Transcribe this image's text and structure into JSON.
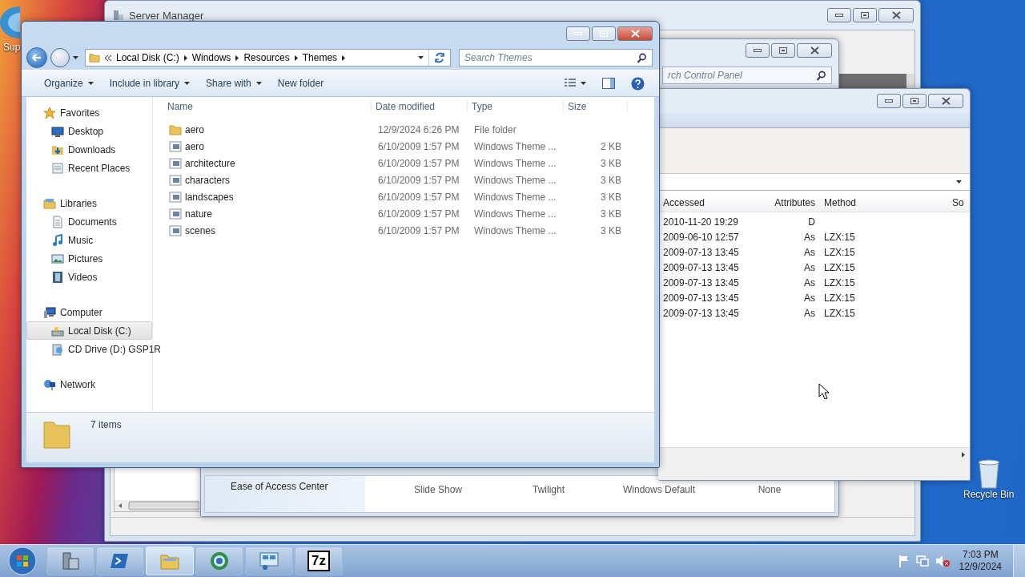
{
  "desktop": {
    "icons": [
      {
        "label": "Sup",
        "kind": "shortcut"
      },
      {
        "label": "Recycle Bin",
        "kind": "recycle"
      }
    ]
  },
  "server_manager": {
    "title": "Server Manager"
  },
  "control_panel": {
    "search": {
      "placeholder": "rch Control Panel"
    },
    "theme_row": {
      "label": "Ease of Access Center",
      "values": [
        "Slide Show",
        "Twilight",
        "Windows Default",
        "None"
      ]
    }
  },
  "archive": {
    "columns": [
      "Accessed",
      "Attributes",
      "Method",
      "So"
    ],
    "rows": [
      {
        "accessed": "2010-11-20 19:29",
        "attributes": "D"
      },
      {
        "accessed": "2009-06-10 12:57",
        "attributes": "As",
        "method": "LZX:15"
      },
      {
        "accessed": "2009-07-13 13:45",
        "attributes": "As",
        "method": "LZX:15"
      },
      {
        "accessed": "2009-07-13 13:45",
        "attributes": "As",
        "method": "LZX:15"
      },
      {
        "accessed": "2009-07-13 13:45",
        "attributes": "As",
        "method": "LZX:15"
      },
      {
        "accessed": "2009-07-13 13:45",
        "attributes": "As",
        "method": "LZX:15"
      },
      {
        "accessed": "2009-07-13 13:45",
        "attributes": "As",
        "method": "LZX:15"
      }
    ]
  },
  "explorer": {
    "breadcrumb": [
      "Local Disk (C:)",
      "Windows",
      "Resources",
      "Themes"
    ],
    "search": {
      "placeholder": "Search Themes"
    },
    "toolbar": [
      {
        "label": "Organize",
        "dropdown": true
      },
      {
        "label": "Include in library",
        "dropdown": true
      },
      {
        "label": "Share with",
        "dropdown": true
      },
      {
        "label": "New folder",
        "dropdown": false
      }
    ],
    "nav": [
      {
        "label": "Favorites",
        "kind": "star",
        "selected": false,
        "children": [
          {
            "label": "Desktop",
            "kind": "desktop",
            "selected": false
          },
          {
            "label": "Downloads",
            "kind": "downloads",
            "selected": false
          },
          {
            "label": "Recent Places",
            "kind": "recent",
            "selected": false
          }
        ]
      },
      {
        "label": "Libraries",
        "kind": "library",
        "selected": false,
        "children": [
          {
            "label": "Documents",
            "kind": "documents",
            "selected": false
          },
          {
            "label": "Music",
            "kind": "music",
            "selected": false
          },
          {
            "label": "Pictures",
            "kind": "pictures",
            "selected": false
          },
          {
            "label": "Videos",
            "kind": "videos",
            "selected": false
          }
        ]
      },
      {
        "label": "Computer",
        "kind": "computer",
        "selected": false,
        "children": [
          {
            "label": "Local Disk (C:)",
            "kind": "disk",
            "selected": true
          },
          {
            "label": "CD Drive (D:) GSP1R",
            "kind": "cd",
            "selected": false
          }
        ]
      },
      {
        "label": "Network",
        "kind": "network",
        "selected": false
      }
    ],
    "columns": [
      "Name",
      "Date modified",
      "Type",
      "Size"
    ],
    "files": [
      {
        "name": "aero",
        "kind": "folder",
        "date": "12/9/2024 6:26 PM",
        "type": "File folder"
      },
      {
        "name": "aero",
        "kind": "theme",
        "date": "6/10/2009 1:57 PM",
        "type": "Windows Theme ...",
        "size": "2 KB"
      },
      {
        "name": "architecture",
        "kind": "theme",
        "date": "6/10/2009 1:57 PM",
        "type": "Windows Theme ...",
        "size": "3 KB"
      },
      {
        "name": "characters",
        "kind": "theme",
        "date": "6/10/2009 1:57 PM",
        "type": "Windows Theme ...",
        "size": "3 KB"
      },
      {
        "name": "landscapes",
        "kind": "theme",
        "date": "6/10/2009 1:57 PM",
        "type": "Windows Theme ...",
        "size": "3 KB"
      },
      {
        "name": "nature",
        "kind": "theme",
        "date": "6/10/2009 1:57 PM",
        "type": "Windows Theme ...",
        "size": "3 KB"
      },
      {
        "name": "scenes",
        "kind": "theme",
        "date": "6/10/2009 1:57 PM",
        "type": "Windows Theme ...",
        "size": "3 KB"
      }
    ],
    "status": "7 items"
  },
  "taskbar": {
    "buttons": [
      {
        "kind": "server",
        "selected": false
      },
      {
        "kind": "shell",
        "selected": false
      },
      {
        "kind": "explorer",
        "selected": true
      },
      {
        "kind": "globe",
        "selected": false
      },
      {
        "kind": "control",
        "selected": false
      },
      {
        "kind": "archiver",
        "label": "7z",
        "selected": false
      }
    ],
    "clock": {
      "time": "7:03 PM",
      "date": "12/9/2024"
    }
  }
}
